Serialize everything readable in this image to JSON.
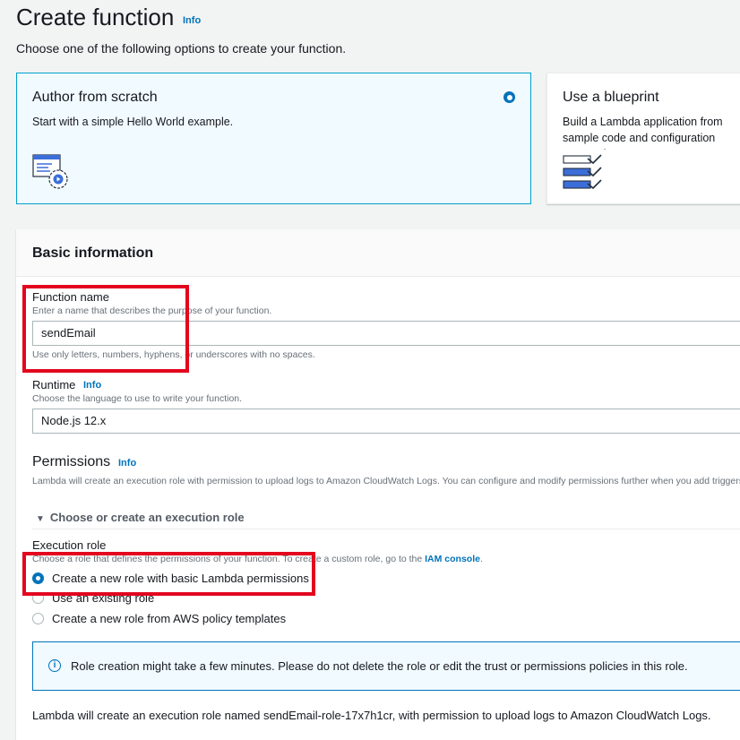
{
  "header": {
    "title": "Create function",
    "info": "Info",
    "subtitle": "Choose one of the following options to create your function."
  },
  "tiles": {
    "scratch": {
      "title": "Author from scratch",
      "description": "Start with a simple Hello World example.",
      "selected": true
    },
    "blueprint": {
      "title": "Use a blueprint",
      "description": "Build a Lambda application from sample code and configuration presets for common use cases."
    }
  },
  "basic_info": {
    "title": "Basic information",
    "function_name": {
      "label": "Function name",
      "description": "Enter a name that describes the purpose of your function.",
      "value": "sendEmail",
      "hint": "Use only letters, numbers, hyphens, or underscores with no spaces."
    },
    "runtime": {
      "label": "Runtime",
      "info": "Info",
      "description": "Choose the language to use to write your function.",
      "value": "Node.js 12.x"
    },
    "permissions": {
      "title": "Permissions",
      "info": "Info",
      "description": "Lambda will create an execution role with permission to upload logs to Amazon CloudWatch Logs. You can configure and modify permissions further when you add triggers.",
      "expander": "Choose or create an execution role",
      "execution_role": {
        "label": "Execution role",
        "description_prefix": "Choose a role that defines the permissions of your function. To create a custom role, go to the ",
        "description_link": "IAM console",
        "description_suffix": ".",
        "options": [
          {
            "label": "Create a new role with basic Lambda permissions",
            "checked": true
          },
          {
            "label": "Use an existing role",
            "checked": false
          },
          {
            "label": "Create a new role from AWS policy templates",
            "checked": false
          }
        ]
      },
      "alert": "Role creation might take a few minutes. Please do not delete the role or edit the trust or permissions policies in this role.",
      "footer": "Lambda will create an execution role named sendEmail-role-17x7h1cr, with permission to upload logs to Amazon CloudWatch Logs."
    }
  },
  "colors": {
    "accent": "#0073bb",
    "selected_tile_bg": "#f1faff",
    "highlight": "#e3061e"
  },
  "icons": [
    "code-settings-icon",
    "blueprint-icon",
    "info-circle-icon",
    "caret-down-icon"
  ]
}
